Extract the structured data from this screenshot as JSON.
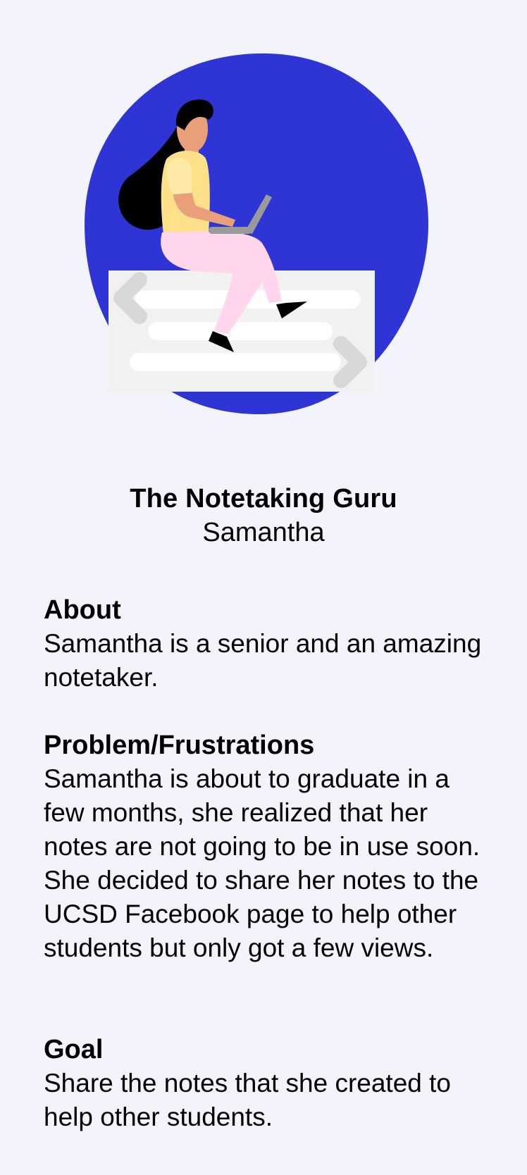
{
  "persona": {
    "title": "The Notetaking Guru",
    "name": "Samantha"
  },
  "sections": {
    "about": {
      "heading": "About",
      "body": "Samantha is a senior and an amazing notetaker."
    },
    "problem": {
      "heading": "Problem/Frustrations",
      "body": "Samantha is about to graduate in a few months, she realized that her notes are not going to be in use soon. She decided to share her notes to the UCSD Facebook page to help other students but only got a few views."
    },
    "goal": {
      "heading": "Goal",
      "body": "Share the notes that she created to help other students."
    }
  },
  "colors": {
    "background": "#f3f4fb",
    "blob": "#2f35d4",
    "card": "#f1f1f1",
    "shirt": "#ffe08a",
    "pants": "#ffd6ee",
    "skin": "#e9a07a",
    "hair": "#000000",
    "laptop": "#9a9a9a"
  },
  "illustration": {
    "icon": "woman-with-laptop-illustration"
  }
}
